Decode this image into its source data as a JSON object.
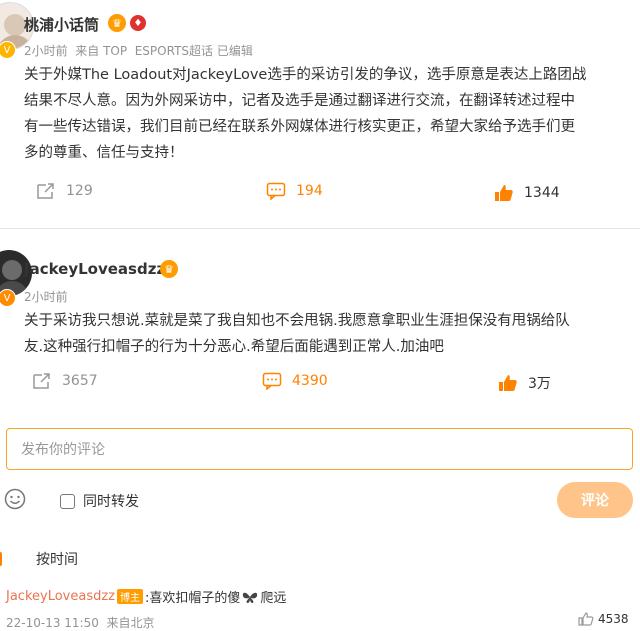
{
  "post1": {
    "author": "桃浦小话筒",
    "meta": "2小时前  来自 TOP  ESPORTS超话 已编辑",
    "lines": [
      "关于外媒The Loadout对JackeyLove选手的采访引发的争议，选手原意是表达上路团战",
      "结果不尽人意。因为外网采访中，记者及选手是通过翻译进行交流，在翻译转述过程中",
      "有一些传达错误，我们目前已经在联系外网媒体进行核实更正，希望大家给予选手们更",
      "多的尊重、信任与支持！"
    ],
    "reposts": "129",
    "comments": "194",
    "likes": "1344"
  },
  "post2": {
    "author": "JackeyLoveasdzz",
    "meta": "2小时前",
    "lines": [
      "关于采访我只想说.菜就是菜了我自知也不会甩锅.我愿意拿职业生涯担保没有甩锅给队",
      "友.这种强行扣帽子的行为十分恶心.希望后面能遇到正常人.加油吧"
    ],
    "reposts": "3657",
    "comments": "4390",
    "likes": "3万"
  },
  "composer": {
    "placeholder": "发布你的评论",
    "repost_label": "同时转发",
    "submit_label": "评论"
  },
  "sort": {
    "label": "按时间"
  },
  "comment": {
    "user": "JackeyLoveasdzz",
    "tag": "博主",
    "text": ":喜欢扣帽子的傻",
    "text2": "爬远",
    "meta": "22-10-13 11:50  来自北京",
    "likes": "4538"
  },
  "colors": {
    "accent": "#ff8200",
    "muted": "#939393",
    "border": "#f5a623"
  }
}
